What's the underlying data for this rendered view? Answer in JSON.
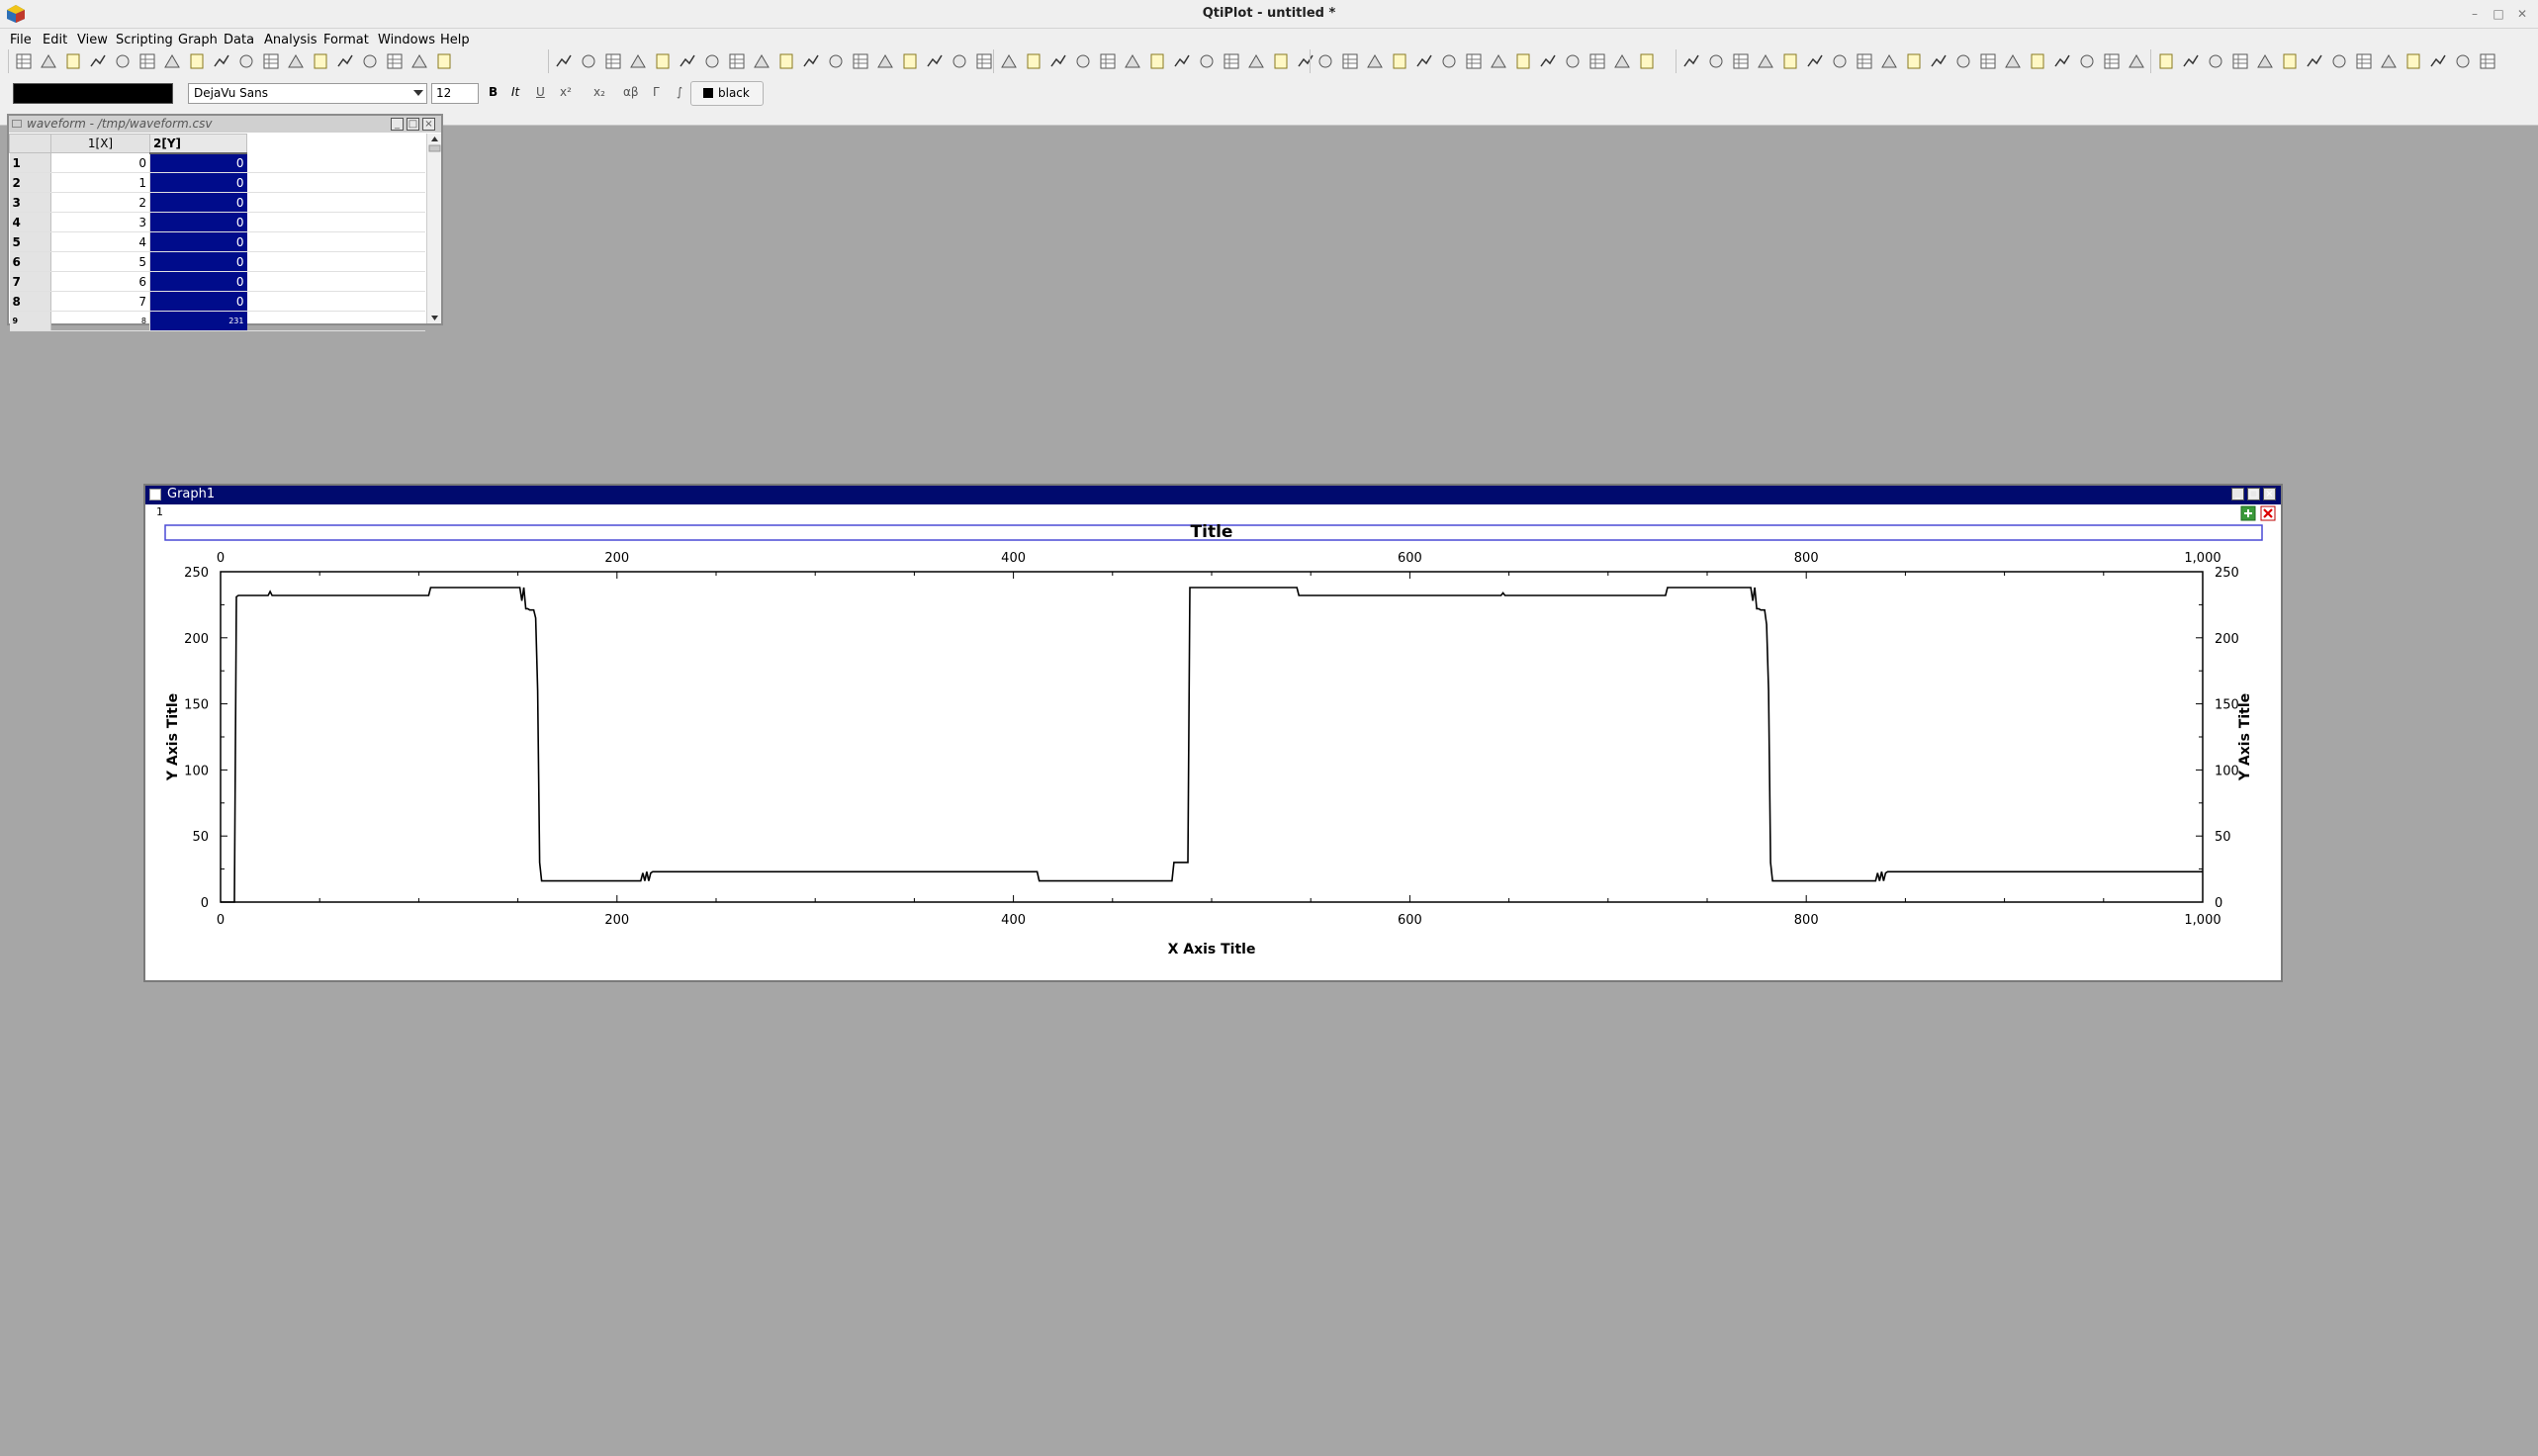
{
  "app": {
    "window_title": "QtiPlot - untitled *",
    "window_buttons": [
      "–",
      "□",
      "✕"
    ]
  },
  "menubar": {
    "items": [
      "File",
      "Edit",
      "View",
      "Scripting",
      "Graph",
      "Data",
      "Analysis",
      "Format",
      "Windows",
      "Help"
    ]
  },
  "format_toolbar": {
    "font": "DejaVu Sans",
    "size": "12",
    "bold": "B",
    "italic": "It",
    "underline": "U",
    "superscript": "x²",
    "subscript": "x₂",
    "greek_lower": "αβ",
    "greek_upper": "Γ",
    "integral": "∫",
    "color_label": "black"
  },
  "table_window": {
    "title": "waveform - /tmp/waveform.csv",
    "columns": [
      "1[X]",
      "2[Y]"
    ],
    "rows": [
      {
        "n": "1",
        "x": "0",
        "y": "0"
      },
      {
        "n": "2",
        "x": "1",
        "y": "0"
      },
      {
        "n": "3",
        "x": "2",
        "y": "0"
      },
      {
        "n": "4",
        "x": "3",
        "y": "0"
      },
      {
        "n": "5",
        "x": "4",
        "y": "0"
      },
      {
        "n": "6",
        "x": "5",
        "y": "0"
      },
      {
        "n": "7",
        "x": "6",
        "y": "0"
      },
      {
        "n": "8",
        "x": "7",
        "y": "0"
      },
      {
        "n": "9",
        "x": "8",
        "y": "231"
      }
    ]
  },
  "graph_window": {
    "title": "Graph1",
    "layer_label": "1"
  },
  "chart_data": {
    "type": "line",
    "title": "Title",
    "xlabel": "X Axis Title",
    "ylabel": "Y Axis Title",
    "right_ylabel": "Y Axis Title",
    "xlim": [
      0,
      1000
    ],
    "ylim": [
      0,
      250
    ],
    "x_ticks": [
      "0",
      "200",
      "400",
      "600",
      "800",
      "1,000"
    ],
    "y_ticks": [
      "0",
      "50",
      "100",
      "150",
      "200",
      "250"
    ],
    "grid": false,
    "color": "#000000",
    "series": [
      {
        "x": [
          0,
          7,
          8,
          9,
          24,
          25,
          26,
          105,
          106,
          151,
          152,
          153,
          154,
          155,
          156,
          158,
          159,
          160,
          161,
          162,
          163,
          212,
          213,
          214,
          215,
          216,
          217,
          218,
          412,
          413,
          480,
          481,
          488,
          489,
          493,
          494,
          543,
          544,
          646,
          647,
          648,
          729,
          730,
          772,
          773,
          774,
          775,
          776,
          777,
          779,
          780,
          781,
          782,
          783,
          784,
          835,
          836,
          837,
          838,
          839,
          840,
          841,
          842,
          1000
        ],
        "y": [
          0,
          0,
          231,
          232,
          232,
          235,
          232,
          232,
          238,
          238,
          228,
          238,
          222,
          222,
          221,
          221,
          215,
          160,
          30,
          16,
          16,
          16,
          22,
          16,
          23,
          16,
          22,
          23,
          23,
          16,
          16,
          30,
          30,
          238,
          238,
          238,
          238,
          232,
          232,
          234,
          232,
          232,
          238,
          238,
          228,
          238,
          222,
          222,
          221,
          221,
          210,
          160,
          30,
          16,
          16,
          16,
          22,
          16,
          23,
          16,
          22,
          23,
          23,
          23
        ]
      }
    ]
  }
}
